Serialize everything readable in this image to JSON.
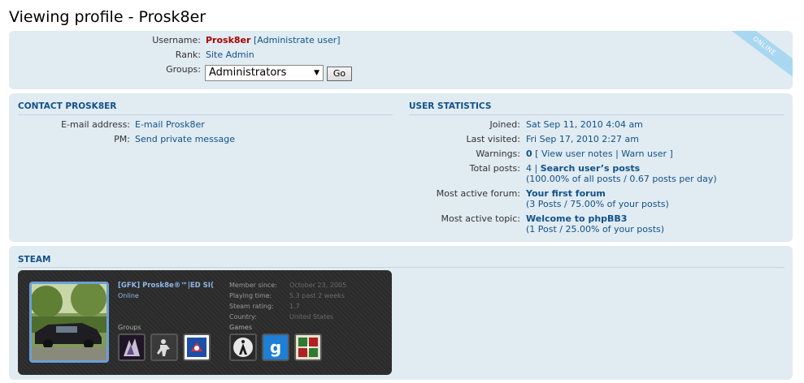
{
  "page": {
    "title": "Viewing profile - Prosk8er"
  },
  "profile": {
    "username_label": "Username:",
    "username": "Prosk8er",
    "admin_link_open": "[",
    "admin_link": "Administrate user",
    "admin_link_close": "]",
    "rank_label": "Rank:",
    "rank": "Site Admin",
    "groups_label": "Groups:",
    "groups_selected": "Administrators",
    "go_label": "Go",
    "online_badge": "ONLINE"
  },
  "contact": {
    "heading": "CONTACT PROSK8ER",
    "email_label": "E-mail address:",
    "email_link": "E-mail Prosk8er",
    "pm_label": "PM:",
    "pm_link": "Send private message"
  },
  "stats": {
    "heading": "USER STATISTICS",
    "joined_label": "Joined:",
    "joined": "Sat Sep 11, 2010 4:04 am",
    "last_visited_label": "Last visited:",
    "last_visited": "Fri Sep 17, 2010 2:27 am",
    "warnings_label": "Warnings:",
    "warnings_count": "0",
    "warnings_open": "[",
    "view_notes": "View user notes",
    "warnings_sep": "|",
    "warn_user": "Warn user",
    "warnings_close": "]",
    "total_posts_label": "Total posts:",
    "total_posts": "4",
    "total_posts_sep": "|",
    "search_posts": "Search user’s posts",
    "posts_detail": "(100.00% of all posts / 0.67 posts per day)",
    "active_forum_label": "Most active forum:",
    "active_forum": "Your first forum",
    "active_forum_detail": "(3 Posts / 75.00% of your posts)",
    "active_topic_label": "Most active topic:",
    "active_topic": "Welcome to phpBB3",
    "active_topic_detail": "(1 Post / 25.00% of your posts)"
  },
  "steam": {
    "heading": "STEAM",
    "name": "[GFK] Prosk8e®™|ED SI(",
    "status": "Online",
    "member_since_label": "Member since:",
    "member_since": "October 23, 2005",
    "playing_time_label": "Playing time:",
    "playing_time": "5.3 past 2 weeks",
    "steam_rating_label": "Steam rating:",
    "steam_rating": "1.7",
    "country_label": "Country:",
    "country": "United States",
    "groups_label": "Groups",
    "games_label": "Games"
  },
  "colors": {
    "panel_bg": "#e1ebf2",
    "link": "#105289",
    "username": "#aa0000",
    "heading": "#105289",
    "online_ribbon": "#a9d7f1"
  }
}
